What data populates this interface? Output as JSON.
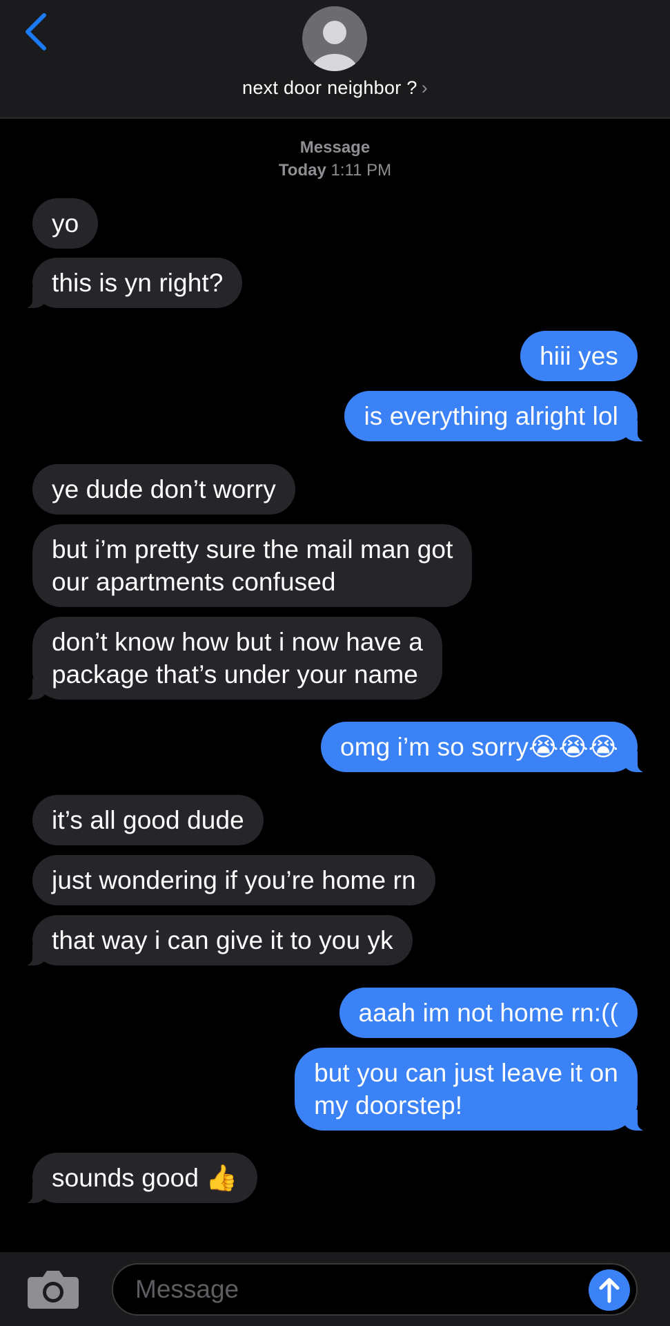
{
  "header": {
    "back_icon": "chevron-left-icon",
    "avatar_icon": "person-silhouette-icon",
    "contact_name": "next door neighbor ?",
    "chevron": "›",
    "accent": "#1a7bf5"
  },
  "timestamp": {
    "service": "Message",
    "day": "Today",
    "time": "1:11 PM"
  },
  "colors": {
    "incoming_bubble": "#26252a",
    "outgoing_bubble": "#3a82f6",
    "background": "#000000",
    "header_bg": "#1b1b1d"
  },
  "messages": [
    {
      "direction": "in",
      "text": "yo"
    },
    {
      "direction": "in",
      "text": "this is yn right?"
    },
    {
      "direction": "out",
      "text": "hiii yes"
    },
    {
      "direction": "out",
      "text": "is everything alright lol"
    },
    {
      "direction": "in",
      "text": "ye dude don’t worry"
    },
    {
      "direction": "in",
      "text": "but i’m pretty sure the mail man got\nour apartments confused"
    },
    {
      "direction": "in",
      "text": "don’t know how but i now have a\npackage that’s under your name"
    },
    {
      "direction": "out",
      "text": "omg i’m so sorry😭😭😭"
    },
    {
      "direction": "in",
      "text": "it’s all good dude"
    },
    {
      "direction": "in",
      "text": "just wondering if you’re home rn"
    },
    {
      "direction": "in",
      "text": "that way i can give it to you yk"
    },
    {
      "direction": "out",
      "text": "aaah im not home rn:(("
    },
    {
      "direction": "out",
      "text": "but you can just leave it on\nmy doorstep!"
    },
    {
      "direction": "in",
      "text": "sounds good 👍"
    }
  ],
  "composer": {
    "camera_icon": "camera-icon",
    "placeholder": "Message",
    "send_icon": "arrow-up-icon"
  }
}
